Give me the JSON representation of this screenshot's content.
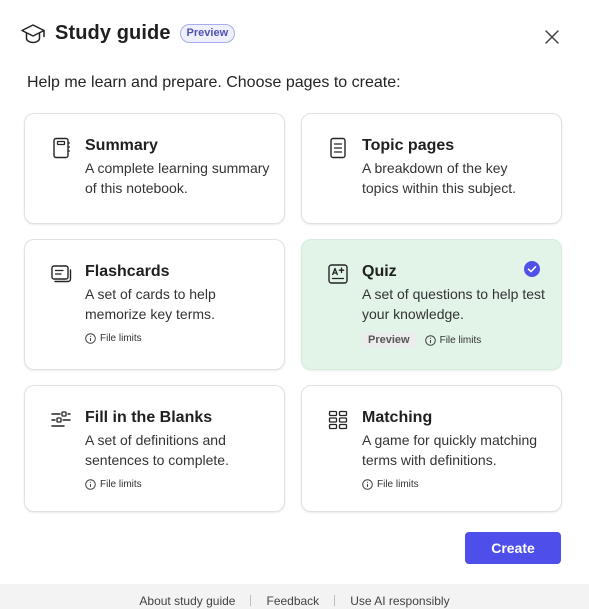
{
  "header": {
    "title": "Study guide",
    "badge": "Preview",
    "icon": "graduation-cap-icon",
    "close_icon": "close-icon"
  },
  "intro": "Help me learn and prepare. Choose pages to create:",
  "cards": [
    {
      "title": "Summary",
      "description": "A complete learning summary of this notebook.",
      "icon": "notebook-icon",
      "selected": false
    },
    {
      "title": "Topic pages",
      "description": "A breakdown of the key topics within this subject.",
      "icon": "document-lines-icon",
      "selected": false
    },
    {
      "title": "Flashcards",
      "description": "A set of cards to help memorize key terms.",
      "icon": "flashcards-icon",
      "meta": "File limits",
      "selected": false
    },
    {
      "title": "Quiz",
      "description": "A set of questions to help test your knowledge.",
      "icon": "quiz-icon",
      "badge": "Preview",
      "meta": "File limits",
      "selected": true
    },
    {
      "title": "Fill in the Blanks",
      "description": "A set of definitions and sentences to complete.",
      "icon": "fill-blanks-icon",
      "meta": "File limits",
      "selected": false
    },
    {
      "title": "Matching",
      "description": "A game for quickly matching terms with definitions.",
      "icon": "matching-grid-icon",
      "meta": "File limits",
      "selected": false
    }
  ],
  "create_label": "Create",
  "footer": {
    "links": [
      "About study guide",
      "Feedback",
      "Use AI responsibly"
    ]
  },
  "colors": {
    "accent": "#4e4feb",
    "selected_card": "#e2f3e8",
    "badge_text": "#4f52b2",
    "check": "#4f52e6"
  }
}
